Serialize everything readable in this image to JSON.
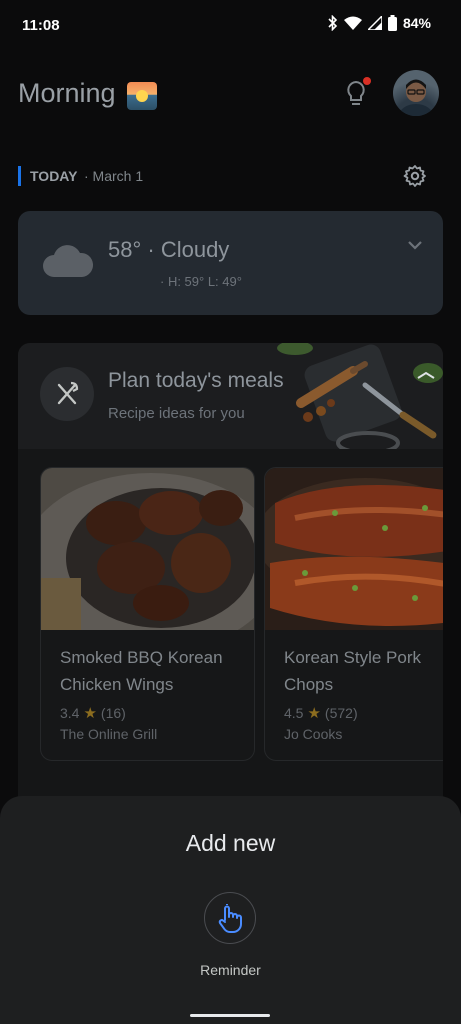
{
  "status_bar": {
    "time": "11:08",
    "battery": "84%"
  },
  "header": {
    "greeting": "Morning"
  },
  "today": {
    "label": "TODAY",
    "date": "· March 1"
  },
  "weather": {
    "summary": "58° · Cloudy",
    "hilo": "· H: 59° L: 49°"
  },
  "meals": {
    "title": "Plan today's meals",
    "subtitle": "Recipe ideas for you",
    "recipes": [
      {
        "title": "Smoked BBQ Korean Chicken Wings",
        "rating": "3.4",
        "reviews": "(16)",
        "source": "The Online Grill"
      },
      {
        "title": "Korean Style Pork Chops",
        "rating": "4.5",
        "reviews": "(572)",
        "source": "Jo Cooks"
      }
    ]
  },
  "sheet": {
    "title": "Add new",
    "reminder_label": "Reminder"
  },
  "colors": {
    "accent": "#1a73e8",
    "notification_dot": "#d93025",
    "reminder_icon": "#4a8cff"
  }
}
